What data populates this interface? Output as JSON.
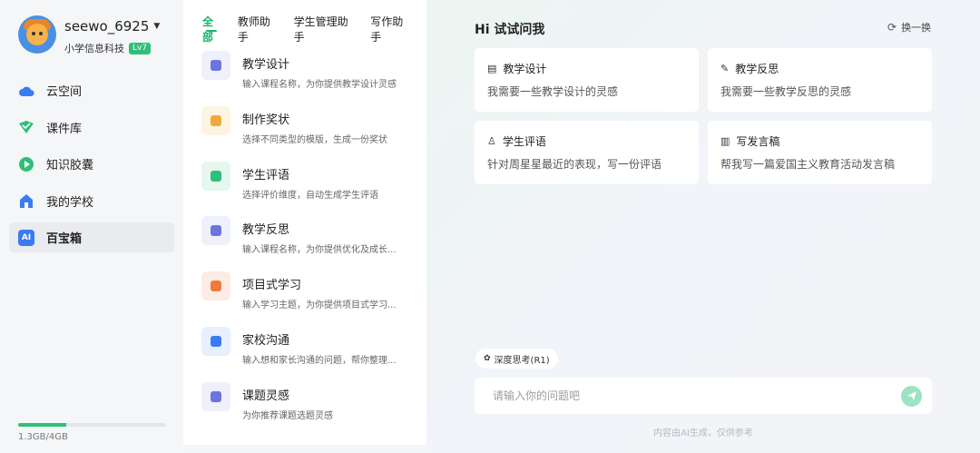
{
  "profile": {
    "username": "seewo_6925",
    "org": "小学信息科技",
    "level": "Lv7"
  },
  "nav": {
    "items": [
      {
        "label": "云空间",
        "icon": "cloud-icon",
        "color": "#3a7bf2"
      },
      {
        "label": "课件库",
        "icon": "courseware-icon",
        "color": "#2fbf78"
      },
      {
        "label": "知识胶囊",
        "icon": "capsule-icon",
        "color": "#2fbf78"
      },
      {
        "label": "我的学校",
        "icon": "school-icon",
        "color": "#3a7bf2"
      },
      {
        "label": "百宝箱",
        "icon": "ai-toolbox-icon",
        "color": "#3a7bf2",
        "badge": "AI"
      }
    ]
  },
  "storage": {
    "text": "1.3GB/4GB",
    "fraction": 0.325
  },
  "tabs": [
    "全部",
    "教师助手",
    "学生管理助手",
    "写作助手"
  ],
  "tools": [
    {
      "name": "教学设计",
      "desc": "输入课程名称，为你提供教学设计灵感",
      "icon": "document-icon",
      "bg": "#eef0fb",
      "color": "#6b74e0"
    },
    {
      "name": "制作奖状",
      "desc": "选择不同类型的模版，生成一份奖状",
      "icon": "award-icon",
      "bg": "#fdf4e2",
      "color": "#f2a93b"
    },
    {
      "name": "学生评语",
      "desc": "选择评价维度，自动生成学生评语",
      "icon": "student-icon",
      "bg": "#e6f7ee",
      "color": "#2fbf78"
    },
    {
      "name": "教学反思",
      "desc": "输入课程名称，为你提供优化及成长...",
      "icon": "reflection-icon",
      "bg": "#eef0fb",
      "color": "#6b74e0"
    },
    {
      "name": "项目式学习",
      "desc": "输入学习主题，为你提供项目式学习...",
      "icon": "project-icon",
      "bg": "#fdece4",
      "color": "#f07a3b"
    },
    {
      "name": "家校沟通",
      "desc": "输入想和家长沟通的问题，帮你整理...",
      "icon": "chat-icon",
      "bg": "#e8f0fd",
      "color": "#3a7bf2"
    },
    {
      "name": "课题灵感",
      "desc": "为你推荐课题选题灵感",
      "icon": "lightbulb-icon",
      "bg": "#eef0fb",
      "color": "#6b74e0"
    }
  ],
  "main": {
    "greeting": "Hi 试试问我",
    "refresh_label": "换一换",
    "cards": [
      {
        "title": "教学设计",
        "sub": "我需要一些教学设计的灵感",
        "icon": "document-icon"
      },
      {
        "title": "教学反思",
        "sub": "我需要一些教学反思的灵感",
        "icon": "reflection-icon"
      },
      {
        "title": "学生评语",
        "sub": "针对周星星最近的表现，写一份评语",
        "icon": "student-icon"
      },
      {
        "title": "写发言稿",
        "sub": "帮我写一篇爱国主义教育活动发言稿",
        "icon": "speech-icon"
      }
    ],
    "deep_think": "深度思考(R1)",
    "input_placeholder": "请输入你的问题吧",
    "disclaimer": "内容由AI生成，仅供参考"
  }
}
